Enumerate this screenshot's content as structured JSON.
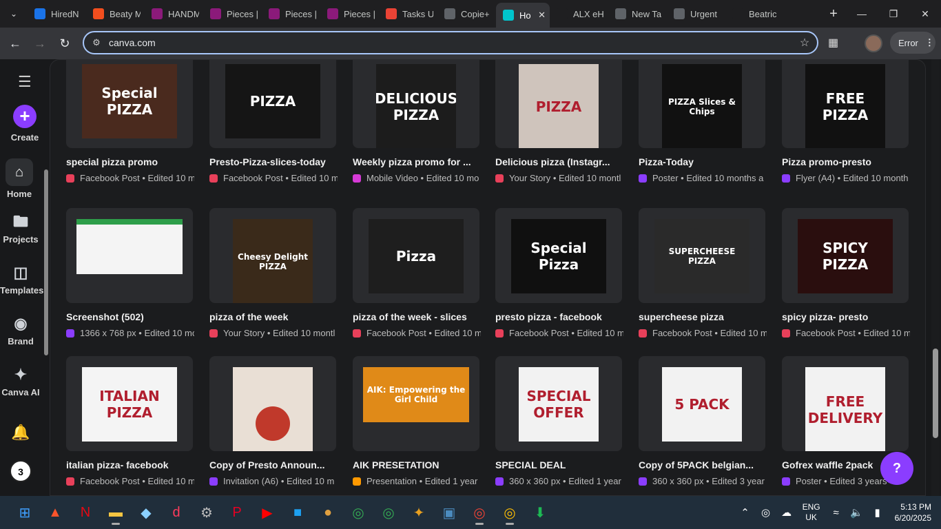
{
  "browser": {
    "tabs": [
      {
        "title": "HiredN",
        "fav_color": "#1a73e8",
        "icon": "hired-icon"
      },
      {
        "title": "Beaty M",
        "fav_color": "#f24e1e",
        "icon": "figma-icon"
      },
      {
        "title": "HANDM",
        "fav_color": "#8b1a7a",
        "icon": "shop-icon"
      },
      {
        "title": "Pieces |",
        "fav_color": "#8b1a7a",
        "icon": "shop-icon"
      },
      {
        "title": "Pieces |",
        "fav_color": "#8b1a7a",
        "icon": "shop-icon"
      },
      {
        "title": "Pieces |",
        "fav_color": "#8b1a7a",
        "icon": "shop-icon"
      },
      {
        "title": "Tasks U",
        "fav_color": "#ea4335",
        "icon": "gmail-icon"
      },
      {
        "title": "Copie+",
        "fav_color": "#5f6368",
        "icon": "globe-icon"
      },
      {
        "title": "Ho",
        "fav_color": "#00c4cc",
        "icon": "canva-icon",
        "active": true
      },
      {
        "title": "ALX eH",
        "fav_color": "#1f1f21",
        "icon": "alx-icon"
      },
      {
        "title": "New Ta",
        "fav_color": "#5f6368",
        "icon": "chrome-icon"
      },
      {
        "title": "Urgent",
        "fav_color": "#5f6368",
        "icon": "globe-icon"
      },
      {
        "title": "Beatric",
        "fav_color": "#1f1f21",
        "icon": "upwork-icon"
      }
    ],
    "url": "canva.com",
    "error_label": "Error"
  },
  "sidebar": {
    "create": "Create",
    "home": "Home",
    "projects": "Projects",
    "templates": "Templates",
    "brand": "Brand",
    "canva_ai": "Canva AI",
    "avatar_letter": "3"
  },
  "designs": [
    {
      "title": "special pizza promo",
      "meta": "Facebook Post • Edited 10 m",
      "badge": "#e8405a",
      "img_text": "Special PIZZA",
      "img_bg": "#4a2a1e",
      "img_w": 138,
      "img_h": 108
    },
    {
      "title": "Presto-Pizza-slices-today",
      "meta": "Facebook Post • Edited 10 m",
      "badge": "#e8405a",
      "img_text": "PIZZA",
      "img_bg": "#151515",
      "img_w": 138,
      "img_h": 108
    },
    {
      "title": "Weekly pizza promo for ...",
      "meta": "Mobile Video • Edited 10 mo",
      "badge": "#d63ad6",
      "img_text": "DELICIOUS PIZZA",
      "img_bg": "#1c1c1c",
      "img_w": 116,
      "img_h": 124
    },
    {
      "title": "Delicious pizza (Instagr...",
      "meta": "Your Story • Edited 10 montl",
      "badge": "#e8405a",
      "img_text": "PIZZA",
      "img_bg": "#cfc4bc",
      "img_w": 116,
      "img_h": 124
    },
    {
      "title": "Pizza-Today",
      "meta": "Poster • Edited 10 months a",
      "badge": "#8b3dff",
      "img_text": "PIZZA Slices & Chips",
      "img_bg": "#111111",
      "img_w": 116,
      "img_h": 124
    },
    {
      "title": "Pizza promo-presto",
      "meta": "Flyer (A4) • Edited 10 month",
      "badge": "#8b3dff",
      "img_text": "FREE PIZZA",
      "img_bg": "#111111",
      "img_w": 116,
      "img_h": 124
    },
    {
      "title": "Screenshot (502)",
      "meta": "1366 x 768 px • Edited 10 mo",
      "badge": "#8b3dff",
      "img_text": "",
      "img_bg": "#f4f4f4",
      "img_w": 154,
      "img_h": 80
    },
    {
      "title": "pizza of the week",
      "meta": "Your Story • Edited 10 montl",
      "badge": "#e8405a",
      "img_text": "Cheesy Delight PIZZA",
      "img_bg": "#3a2a1a",
      "img_w": 116,
      "img_h": 124
    },
    {
      "title": "pizza of the week - slices",
      "meta": "Facebook Post • Edited 10 m",
      "badge": "#e8405a",
      "img_text": "Pizza",
      "img_bg": "#1e1e1e",
      "img_w": 138,
      "img_h": 108
    },
    {
      "title": "presto pizza - facebook",
      "meta": "Facebook Post • Edited 10 m",
      "badge": "#e8405a",
      "img_text": "Special Pizza",
      "img_bg": "#101010",
      "img_w": 138,
      "img_h": 108
    },
    {
      "title": "supercheese pizza",
      "meta": "Facebook Post • Edited 10 m",
      "badge": "#e8405a",
      "img_text": "SUPERCHEESE PIZZA",
      "img_bg": "#2a2a2a",
      "img_w": 138,
      "img_h": 108
    },
    {
      "title": "spicy pizza- presto",
      "meta": "Facebook Post • Edited 10 m",
      "badge": "#e8405a",
      "img_text": "SPICY PIZZA",
      "img_bg": "#2a0e0e",
      "img_w": 138,
      "img_h": 108
    },
    {
      "title": "italian pizza- facebook",
      "meta": "Facebook Post • Edited 10 m",
      "badge": "#e8405a",
      "img_text": "ITALIAN PIZZA",
      "img_bg": "#f4f4f4",
      "img_w": 138,
      "img_h": 108
    },
    {
      "title": "Copy of Presto Announ...",
      "meta": "Invitation (A6) • Edited 10 m",
      "badge": "#8b3dff",
      "img_text": "",
      "img_bg": "#e9dfd5",
      "img_w": 116,
      "img_h": 124
    },
    {
      "title": "AIK PRESETATION",
      "meta": "Presentation • Edited 1 year",
      "badge": "#ff9900",
      "img_text": "AIK: Empowering the Girl Child",
      "img_bg": "#e08a18",
      "img_w": 154,
      "img_h": 80
    },
    {
      "title": "SPECIAL DEAL",
      "meta": "360 x 360 px • Edited 1 year",
      "badge": "#8b3dff",
      "img_text": "SPECIAL OFFER",
      "img_bg": "#f2f2f2",
      "img_w": 116,
      "img_h": 108
    },
    {
      "title": "Copy of 5PACK belgian...",
      "meta": "360 x 360 px • Edited 3 year",
      "badge": "#8b3dff",
      "img_text": "5 PACK",
      "img_bg": "#f2f2f2",
      "img_w": 116,
      "img_h": 108
    },
    {
      "title": "Gofrex waffle 2pack",
      "meta": "Poster • Edited 3 years",
      "badge": "#8b3dff",
      "img_text": "FREE DELIVERY",
      "img_bg": "#f2f2f2",
      "img_w": 116,
      "img_h": 124
    }
  ],
  "help_label": "?",
  "taskbar": {
    "lang_top": "ENG",
    "lang_bottom": "UK",
    "time": "5:13 PM",
    "date": "6/20/2025"
  }
}
